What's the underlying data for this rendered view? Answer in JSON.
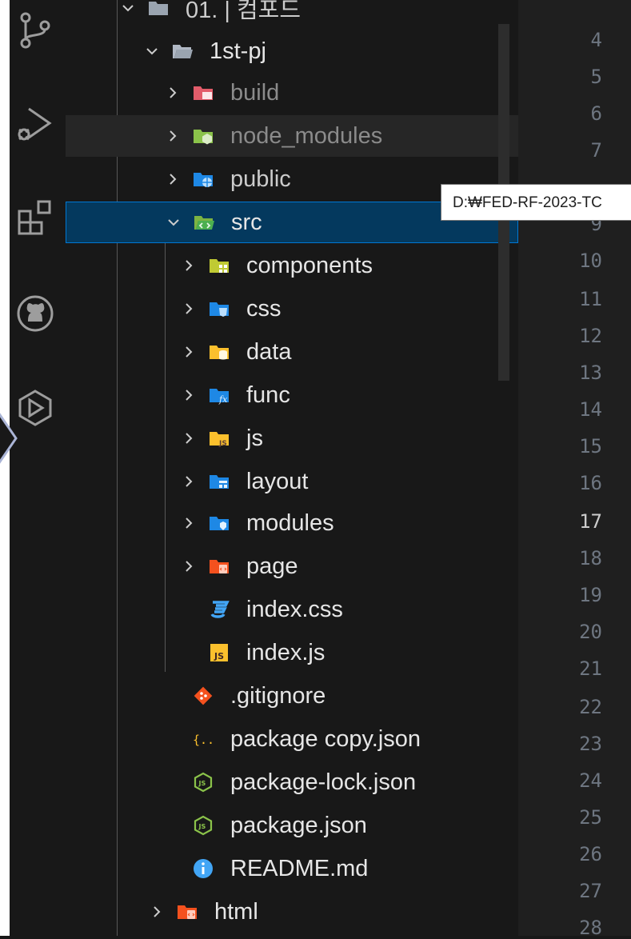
{
  "activity_bar": {
    "items": [
      {
        "name": "source-control-icon"
      },
      {
        "name": "run-and-debug-icon"
      },
      {
        "name": "extensions-icon"
      },
      {
        "name": "github-icon"
      },
      {
        "name": "remote-explorer-icon"
      }
    ]
  },
  "explorer": {
    "top_partial_label": "01. | 컴포드",
    "project": "1st-pj",
    "folders_top": [
      "build",
      "node_modules",
      "public"
    ],
    "src": {
      "label": "src",
      "folders": [
        "components",
        "css",
        "data",
        "func",
        "js",
        "layout",
        "modules",
        "page"
      ],
      "files": [
        "index.css",
        "index.js"
      ]
    },
    "root_files": [
      ".gitignore",
      "package copy.json",
      "package-lock.json",
      "package.json",
      "README.md"
    ],
    "bottom_folder": "html"
  },
  "tooltip": {
    "text": "D:₩FED-RF-2023-TC"
  },
  "editor": {
    "line_numbers": [
      "4",
      "5",
      "6",
      "7",
      "9",
      "10",
      "11",
      "12",
      "13",
      "14",
      "15",
      "16",
      "17",
      "18",
      "19",
      "20",
      "21",
      "22",
      "23",
      "24",
      "25",
      "26",
      "27",
      "28"
    ],
    "active_line": "17"
  },
  "colors": {
    "selection_bg": "#04395e",
    "selection_border": "#0078d4",
    "tooltip_bg": "#ffffff"
  }
}
